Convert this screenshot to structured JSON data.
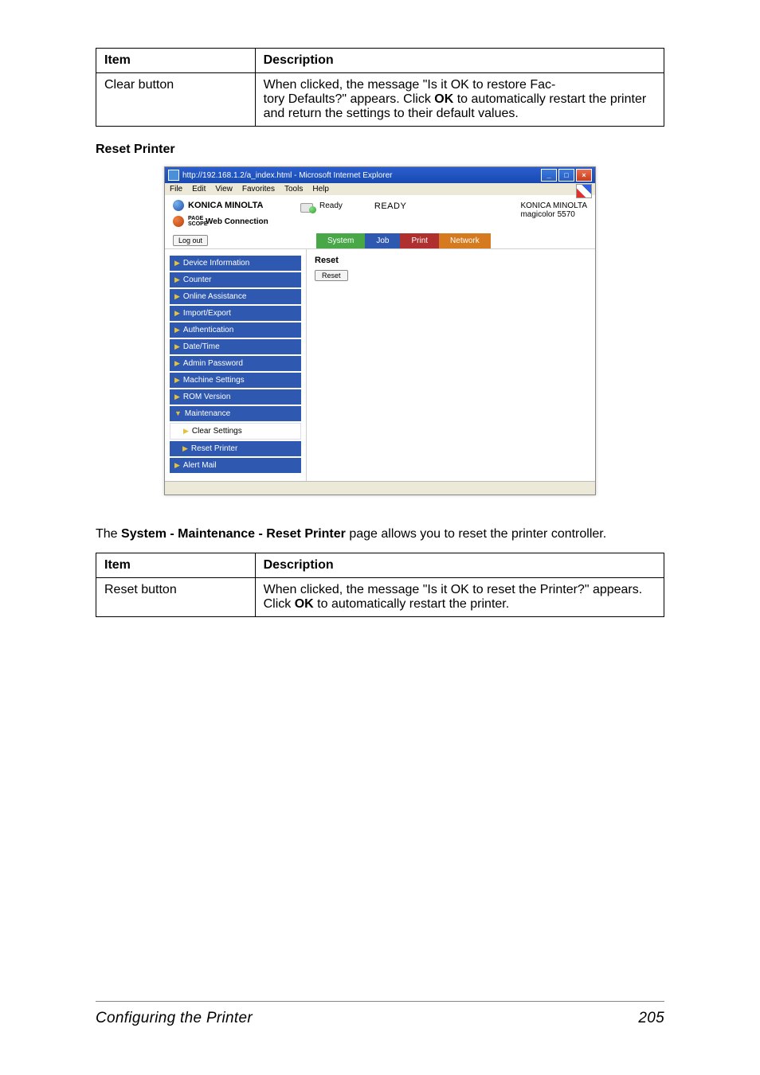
{
  "table1": {
    "head_item": "Item",
    "head_desc": "Description",
    "row_item": "Clear button",
    "row_desc_1": "When clicked, the message \"Is it OK to restore Fac-",
    "row_desc_2": "tory Defaults?\" appears. Click ",
    "row_desc_bold": "OK",
    "row_desc_3": " to automatically restart the printer and return the settings to their default values."
  },
  "section_title": "Reset Printer",
  "browser": {
    "title": "http://192.168.1.2/a_index.html - Microsoft Internet Explorer",
    "menu": {
      "file": "File",
      "edit": "Edit",
      "view": "View",
      "favorites": "Favorites",
      "tools": "Tools",
      "help": "Help"
    },
    "brand_km": "KONICA MINOLTA",
    "brand_pc_prefix": "PAGE SCOPE",
    "brand_pc": " Web Connection",
    "ready_small": "Ready",
    "ready_big": "READY",
    "model_brand": "KONICA MINOLTA",
    "model_name": "magicolor 5570",
    "logout": "Log out",
    "tabs": {
      "system": "System",
      "job": "Job",
      "print": "Print",
      "network": "Network"
    },
    "nav": {
      "device_info": "Device Information",
      "counter": "Counter",
      "online_assist": "Online Assistance",
      "import_export": "Import/Export",
      "authentication": "Authentication",
      "date_time": "Date/Time",
      "admin_password": "Admin Password",
      "machine_settings": "Machine Settings",
      "rom_version": "ROM Version",
      "maintenance": "Maintenance",
      "clear_settings": "Clear Settings",
      "reset_printer": "Reset Printer",
      "alert_mail": "Alert Mail"
    },
    "panel_title": "Reset",
    "reset_btn": "Reset"
  },
  "explain_1": "The ",
  "explain_bold": "System - Maintenance - Reset Printer",
  "explain_2": " page allows you to reset the printer controller.",
  "table2": {
    "head_item": "Item",
    "head_desc": "Description",
    "row_item": "Reset button",
    "row_desc_1": "When clicked, the message \"Is it OK to reset the Printer?\" appears. Click ",
    "row_desc_bold": "OK",
    "row_desc_2": " to automatically restart the printer."
  },
  "footer_left": "Configuring the Printer",
  "footer_right": "205"
}
